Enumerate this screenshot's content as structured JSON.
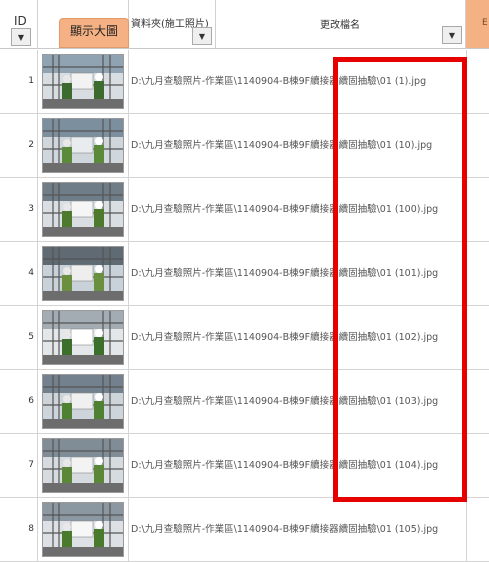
{
  "header": {
    "id_label": "ID",
    "thumb_button_label": "顯示大圖",
    "path_label": "資料夾(施工照片)",
    "name_label": "更改檔名",
    "dropdown_glyph": "▼",
    "extra_mark": "E",
    "colors": {
      "accent": "#f4b183",
      "highlight": "#e60000"
    }
  },
  "rows": [
    {
      "id": "1",
      "path": "D:\\九月查驗照片-作業區\\1140904-B棟9F續接器續固抽驗\\01 (1).jpg",
      "thumb": "site-photo-1"
    },
    {
      "id": "2",
      "path": "D:\\九月查驗照片-作業區\\1140904-B棟9F續接器續固抽驗\\01 (10).jpg",
      "thumb": "site-photo-2"
    },
    {
      "id": "3",
      "path": "D:\\九月查驗照片-作業區\\1140904-B棟9F續接器續固抽驗\\01 (100).jpg",
      "thumb": "site-photo-3"
    },
    {
      "id": "4",
      "path": "D:\\九月查驗照片-作業區\\1140904-B棟9F續接器續固抽驗\\01 (101).jpg",
      "thumb": "site-photo-4"
    },
    {
      "id": "5",
      "path": "D:\\九月查驗照片-作業區\\1140904-B棟9F續接器續固抽驗\\01 (102).jpg",
      "thumb": "site-photo-5"
    },
    {
      "id": "6",
      "path": "D:\\九月查驗照片-作業區\\1140904-B棟9F續接器續固抽驗\\01 (103).jpg",
      "thumb": "site-photo-6"
    },
    {
      "id": "7",
      "path": "D:\\九月查驗照片-作業區\\1140904-B棟9F續接器續固抽驗\\01 (104).jpg",
      "thumb": "site-photo-7"
    },
    {
      "id": "8",
      "path": "D:\\九月查驗照片-作業區\\1140904-B棟9F續接器續固抽驗\\01 (105).jpg",
      "thumb": "site-photo-8"
    }
  ]
}
